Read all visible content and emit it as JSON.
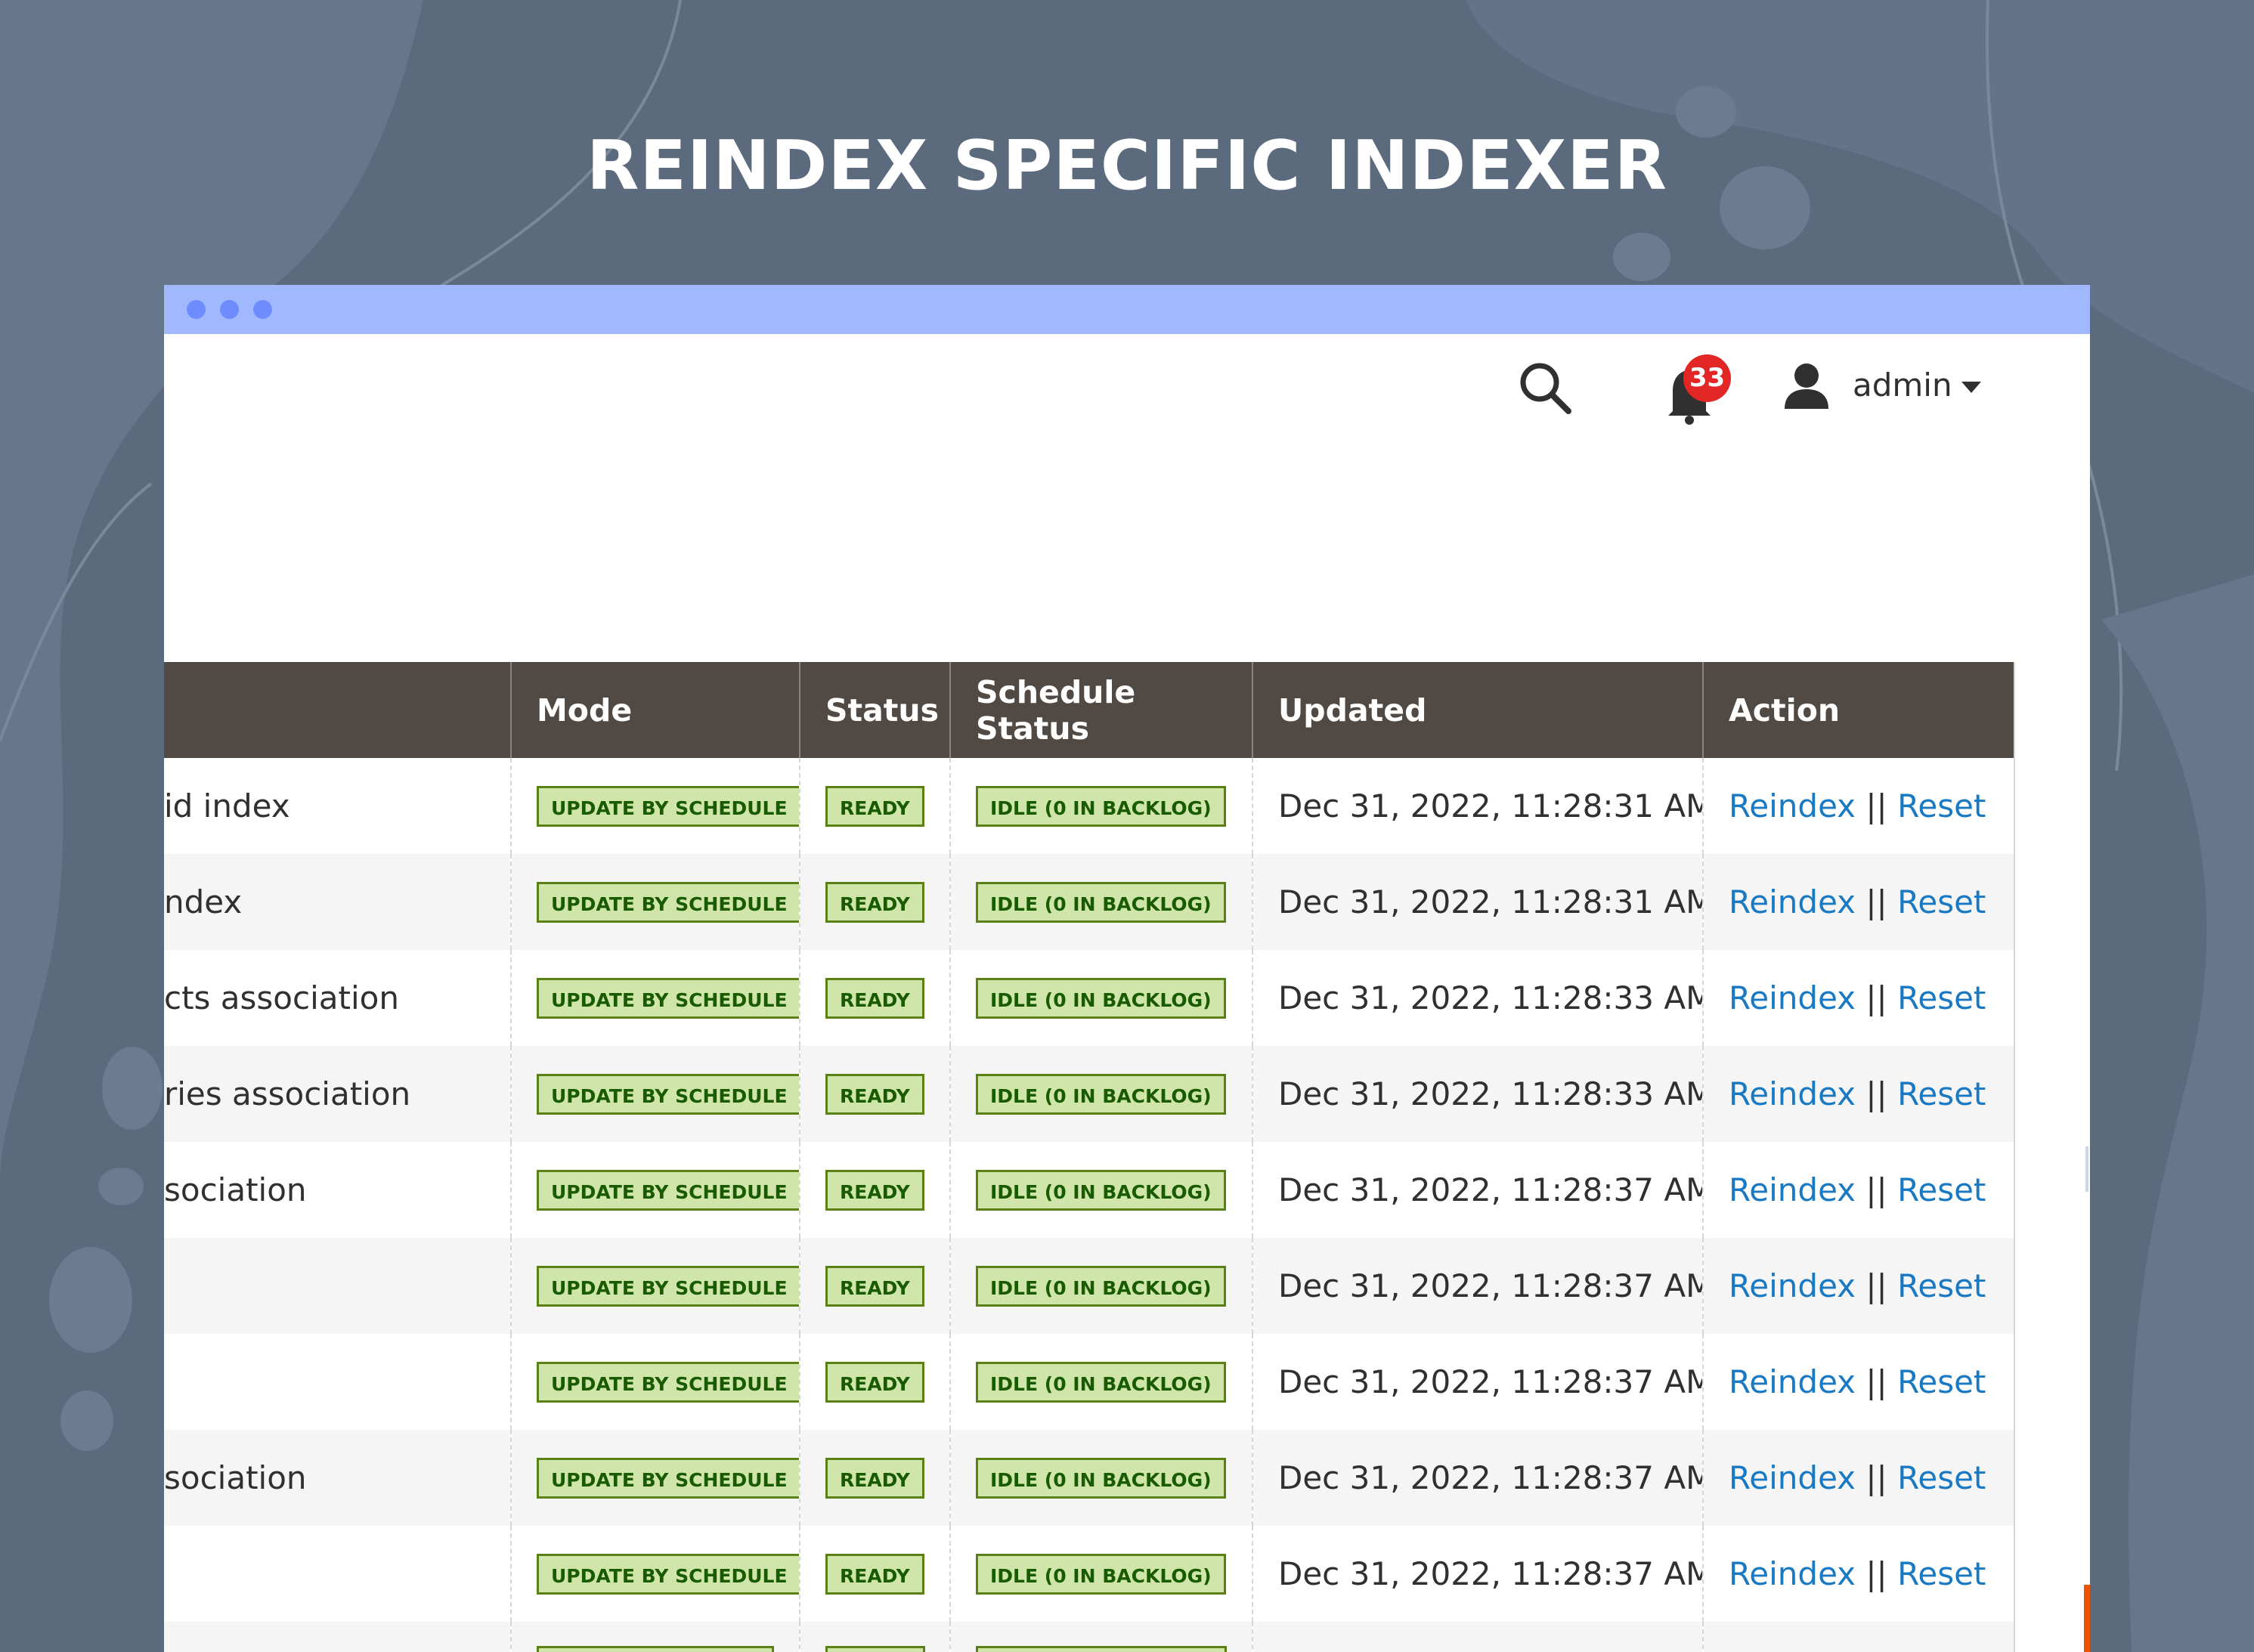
{
  "headline": "REINDEX SPECIFIC INDEXER",
  "colors": {
    "background": "#5b6a7d",
    "titlebar": "#a1b8ff",
    "table_header": "#514943",
    "link": "#1979c3",
    "pill_bg": "#d0e5a9",
    "pill_text": "#185b00",
    "badge": "#e22626"
  },
  "header": {
    "search_icon": "search-icon",
    "bell_icon": "bell-icon",
    "notification_count": "33",
    "avatar_icon": "user-icon",
    "admin_label": "admin"
  },
  "table": {
    "columns": [
      "",
      "Mode",
      "Status",
      "Schedule Status",
      "Updated",
      "Action"
    ],
    "rows": [
      {
        "indexer": "id index",
        "mode": "UPDATE BY SCHEDULE",
        "status": "READY",
        "schedule": "IDLE (0 IN BACKLOG)",
        "updated": "Dec 31, 2022, 11:28:31 AM",
        "reindex": "Reindex",
        "sep": "||",
        "reset": "Reset"
      },
      {
        "indexer": "ndex",
        "mode": "UPDATE BY SCHEDULE",
        "status": "READY",
        "schedule": "IDLE (0 IN BACKLOG)",
        "updated": "Dec 31, 2022, 11:28:31 AM",
        "reindex": "Reindex",
        "sep": "||",
        "reset": "Reset"
      },
      {
        "indexer": "cts association",
        "mode": "UPDATE BY SCHEDULE",
        "status": "READY",
        "schedule": "IDLE (0 IN BACKLOG)",
        "updated": "Dec 31, 2022, 11:28:33 AM",
        "reindex": "Reindex",
        "sep": "||",
        "reset": "Reset"
      },
      {
        "indexer": "ries association",
        "mode": "UPDATE BY SCHEDULE",
        "status": "READY",
        "schedule": "IDLE (0 IN BACKLOG)",
        "updated": "Dec 31, 2022, 11:28:33 AM",
        "reindex": "Reindex",
        "sep": "||",
        "reset": "Reset"
      },
      {
        "indexer": "sociation",
        "mode": "UPDATE BY SCHEDULE",
        "status": "READY",
        "schedule": "IDLE (0 IN BACKLOG)",
        "updated": "Dec 31, 2022, 11:28:37 AM",
        "reindex": "Reindex",
        "sep": "||",
        "reset": "Reset"
      },
      {
        "indexer": "",
        "mode": "UPDATE BY SCHEDULE",
        "status": "READY",
        "schedule": "IDLE (0 IN BACKLOG)",
        "updated": "Dec 31, 2022, 11:28:37 AM",
        "reindex": "Reindex",
        "sep": "||",
        "reset": "Reset"
      },
      {
        "indexer": "",
        "mode": "UPDATE BY SCHEDULE",
        "status": "READY",
        "schedule": "IDLE (0 IN BACKLOG)",
        "updated": "Dec 31, 2022, 11:28:37 AM",
        "reindex": "Reindex",
        "sep": "||",
        "reset": "Reset"
      },
      {
        "indexer": "sociation",
        "mode": "UPDATE BY SCHEDULE",
        "status": "READY",
        "schedule": "IDLE (0 IN BACKLOG)",
        "updated": "Dec 31, 2022, 11:28:37 AM",
        "reindex": "Reindex",
        "sep": "||",
        "reset": "Reset"
      },
      {
        "indexer": "",
        "mode": "UPDATE BY SCHEDULE",
        "status": "READY",
        "schedule": "IDLE (0 IN BACKLOG)",
        "updated": "Dec 31, 2022, 11:28:37 AM",
        "reindex": "Reindex",
        "sep": "||",
        "reset": "Reset"
      },
      {
        "indexer": "",
        "mode": "",
        "status": "",
        "schedule": "",
        "updated": "",
        "reindex": "",
        "sep": "",
        "reset": ""
      }
    ]
  }
}
